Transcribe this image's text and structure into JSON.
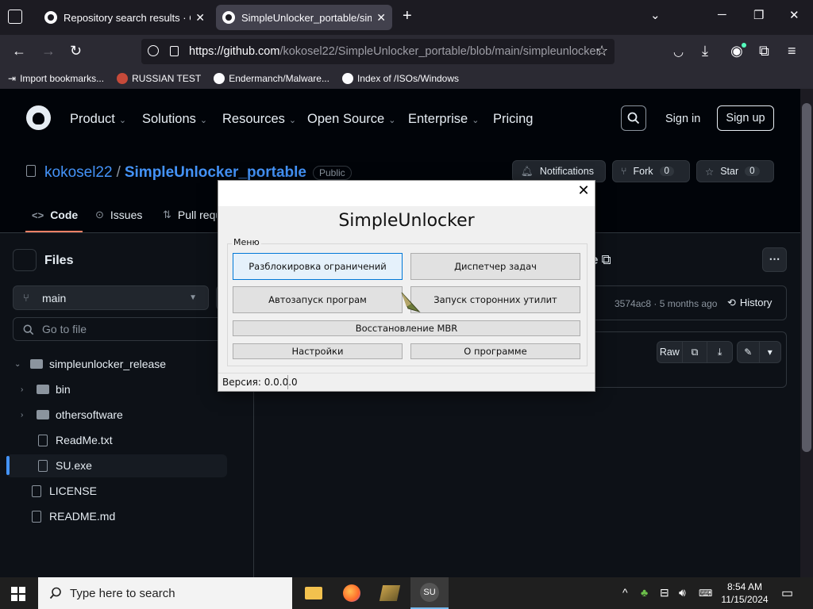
{
  "browser": {
    "tabs": [
      {
        "title": "Repository search results · GitHub",
        "active": false
      },
      {
        "title": "SimpleUnlocker_portable/simpleunlocker",
        "active": true
      }
    ],
    "new_tab": "+",
    "url": {
      "host": "https://github.com",
      "path": "/kokosel22/SimpleUnlocker_portable/blob/main/simpleunlocker"
    },
    "bookmarks": [
      "Import bookmarks...",
      "RUSSIAN TEST",
      "Endermanch/Malware...",
      "Index of /ISOs/Windows"
    ]
  },
  "github": {
    "nav": [
      "Product",
      "Solutions",
      "Resources",
      "Open Source",
      "Enterprise",
      "Pricing"
    ],
    "sign_in": "Sign in",
    "sign_up": "Sign up",
    "repo": {
      "owner": "kokosel22",
      "sep": "/",
      "name": "SimpleUnlocker_portable",
      "visibility": "Public"
    },
    "buttons": {
      "notifications": "Notifications",
      "fork": "Fork",
      "fork_count": "0",
      "star": "Star",
      "star_count": "0"
    },
    "tabs": [
      "Code",
      "Issues",
      "Pull requests"
    ],
    "files_title": "Files",
    "branch": "main",
    "goto_placeholder": "Go to file",
    "tree": [
      {
        "name": "simpleunlocker_release",
        "kind": "folder"
      },
      {
        "name": "bin",
        "kind": "folder"
      },
      {
        "name": "othersoftware",
        "kind": "folder"
      },
      {
        "name": "ReadMe.txt",
        "kind": "file"
      },
      {
        "name": "SU.exe",
        "kind": "file"
      },
      {
        "name": "LICENSE",
        "kind": "file"
      },
      {
        "name": "README.md",
        "kind": "file"
      }
    ],
    "file_tail": "e",
    "commit": "3574ac8 · 5 months ago",
    "history": "History",
    "raw": "Raw"
  },
  "dialog": {
    "title": "SimpleUnlocker",
    "group_label": "Меню",
    "buttons": {
      "unlock": "Разблокировка ограничений",
      "taskmgr": "Диспетчер задач",
      "autorun": "Автозапуск програм",
      "utils": "Запуск сторонних утилит",
      "mbr": "Восстановление MBR",
      "settings": "Настройки",
      "about": "О программе"
    },
    "version": "Версия: 0.0.0.0",
    "close": "✕"
  },
  "taskbar": {
    "search_placeholder": "Type here to search",
    "su_label": "SU",
    "time": "8:54 AM",
    "date": "11/15/2024"
  }
}
